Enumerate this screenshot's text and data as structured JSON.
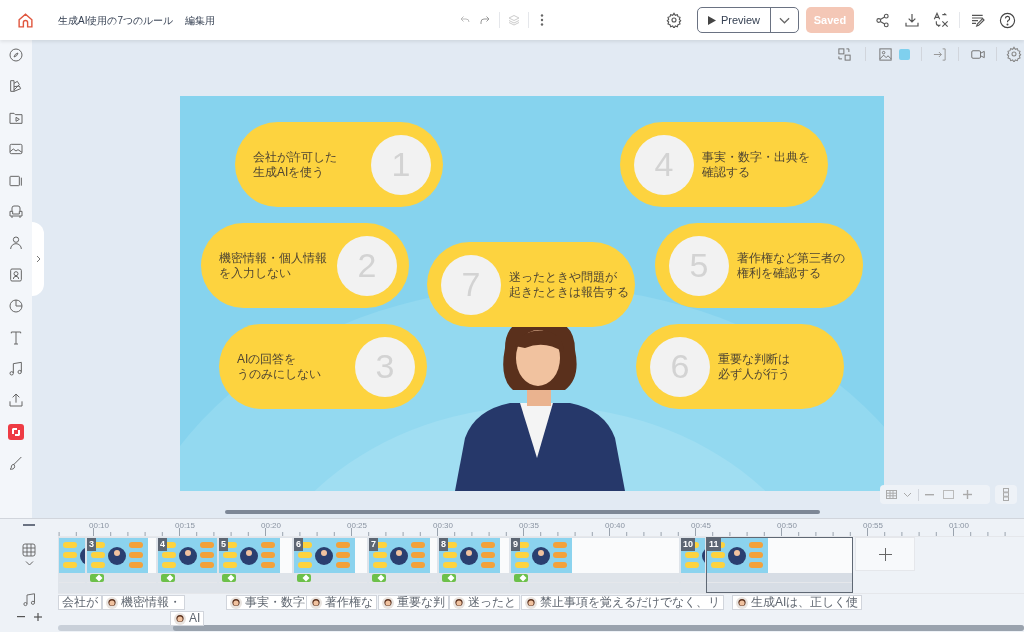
{
  "header": {
    "title": "生成AI使用の7つのルール",
    "subtitle": "編集用",
    "preview_label": "Preview",
    "save_label": "Saved",
    "save_disabled": true
  },
  "slide": {
    "rules": [
      {
        "number": "1",
        "lines": [
          "会社が許可した",
          "生成AIを使う"
        ]
      },
      {
        "number": "2",
        "lines": [
          "機密情報・個人情報",
          "を入力しない"
        ]
      },
      {
        "number": "3",
        "lines": [
          "AIの回答を",
          "うのみにしない"
        ]
      },
      {
        "number": "4",
        "lines": [
          "事実・数字・出典を",
          "確認する"
        ]
      },
      {
        "number": "5",
        "lines": [
          "著作権など第三者の",
          "権利を確認する"
        ]
      },
      {
        "number": "6",
        "lines": [
          "重要な判断は",
          "必ず人が行う"
        ]
      },
      {
        "number": "7",
        "lines": [
          "迷ったときや問題が",
          "起きたときは報告する"
        ]
      }
    ]
  },
  "timeline": {
    "ticks": [
      "00:10",
      "00:15",
      "00:20",
      "00:25",
      "00:30",
      "00:35",
      "00:40",
      "00:45",
      "00:50",
      "00:55",
      "01:00"
    ],
    "scenes": [
      {
        "selected": false,
        "transition": false
      },
      {
        "number": "3",
        "selected": false,
        "transition": true
      },
      {
        "number": "4",
        "selected": false,
        "transition": true
      },
      {
        "number": "5",
        "selected": false,
        "transition": true
      },
      {
        "number": "6",
        "selected": false,
        "transition": true
      },
      {
        "number": "7",
        "selected": false,
        "transition": true
      },
      {
        "number": "8",
        "selected": false,
        "transition": true
      },
      {
        "number": "9",
        "selected": false,
        "transition": true
      },
      {
        "number": "10",
        "selected": false,
        "transition": false
      },
      {
        "number": "11",
        "selected": true,
        "transition": false
      }
    ],
    "audio_clips": [
      {
        "text": "会社が",
        "avatar": false
      },
      {
        "text": "機密情報・",
        "avatar": true
      },
      {
        "text": "AI",
        "avatar": true
      },
      {
        "text": "事実・数字",
        "avatar": true
      },
      {
        "text": "著作権な",
        "avatar": true
      },
      {
        "text": "重要な判",
        "avatar": true
      },
      {
        "text": "迷ったと",
        "avatar": true
      },
      {
        "text": "禁止事項を覚えるだけでなく、リ",
        "avatar": true
      },
      {
        "text": "生成AIは、正しく使",
        "avatar": true
      }
    ]
  }
}
